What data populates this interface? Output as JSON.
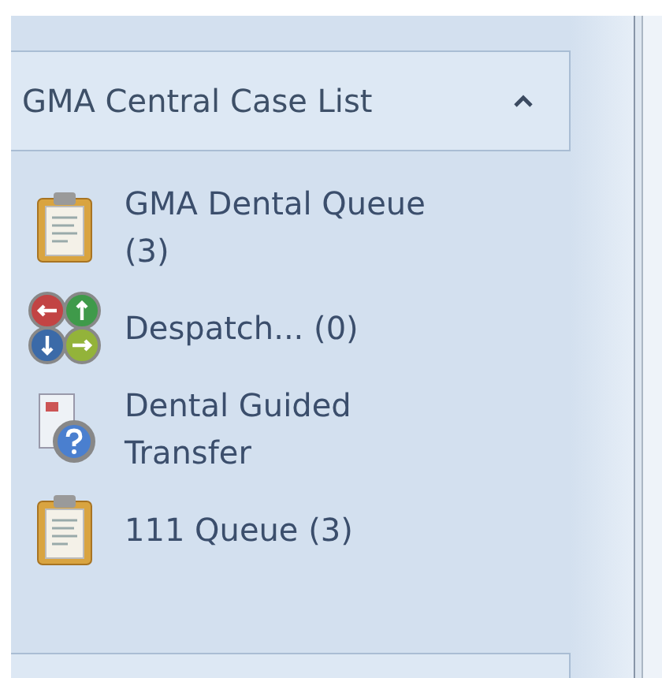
{
  "panel": {
    "title": "GMA Central Case List",
    "expanded": true,
    "items": [
      {
        "kind": "clipboard",
        "label": "GMA Dental Queue (3)"
      },
      {
        "kind": "arrows",
        "label": "Despatch... (0)"
      },
      {
        "kind": "transfer",
        "label": "Dental Guided Transfer"
      },
      {
        "kind": "clipboard",
        "label": "111 Queue (3)"
      }
    ]
  }
}
